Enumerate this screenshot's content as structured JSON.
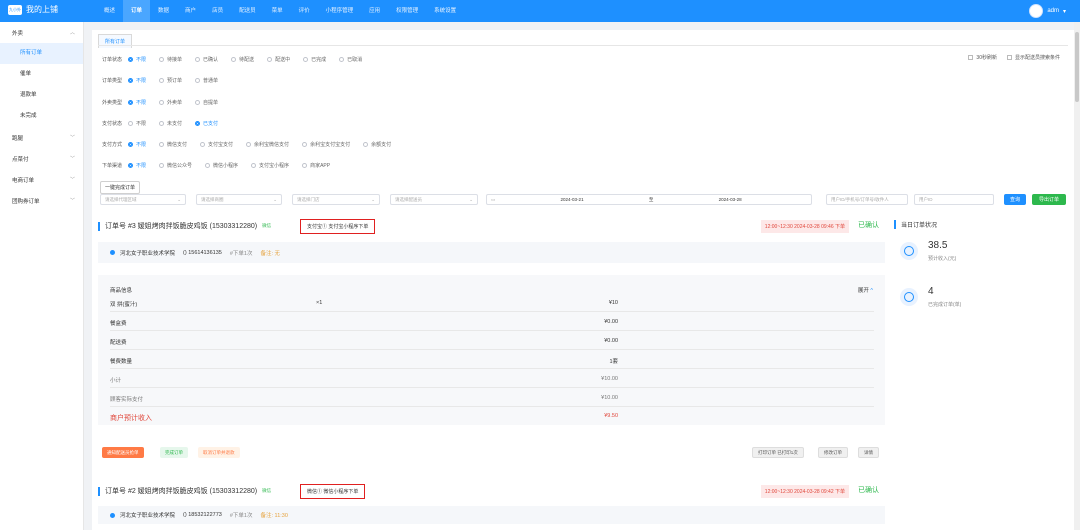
{
  "app": {
    "logo_badge": "九小外",
    "title": "我的上铺",
    "user": "adm"
  },
  "nav": [
    "概述",
    "订单",
    "数据",
    "商户",
    "店员",
    "配送员",
    "菜单",
    "评价",
    "小程序管理",
    "应用",
    "权限管理",
    "系统设置"
  ],
  "sidebar": [
    {
      "label": "外卖",
      "type": "group",
      "chevron": "up"
    },
    {
      "label": "所有订单",
      "type": "item",
      "active": true
    },
    {
      "label": "催单",
      "type": "item"
    },
    {
      "label": "退款单",
      "type": "item"
    },
    {
      "label": "未完成",
      "type": "item"
    },
    {
      "label": "跑腿",
      "type": "group",
      "chevron": "down"
    },
    {
      "label": "点菜付",
      "type": "group",
      "chevron": "down"
    },
    {
      "label": "电商订单",
      "type": "group",
      "chevron": "down"
    },
    {
      "label": "团购券订单",
      "type": "group",
      "chevron": "down"
    }
  ],
  "tab": "所有订单",
  "filters": [
    {
      "label": "订单状态",
      "options": [
        "不限",
        "待接单",
        "已确认",
        "待配送",
        "配送中",
        "已完成",
        "已取消"
      ],
      "selected": 0
    },
    {
      "label": "订单类型",
      "options": [
        "不限",
        "预订单",
        "普通单"
      ],
      "selected": 0
    },
    {
      "label": "外卖类型",
      "options": [
        "不限",
        "外卖单",
        "自提单"
      ],
      "selected": 0
    },
    {
      "label": "支付状态",
      "options": [
        "不限",
        "未支付",
        "已支付"
      ],
      "selected": 2
    },
    {
      "label": "支付方式",
      "options": [
        "不限",
        "微信支付",
        "支付宝支付",
        "余利宝微信支付",
        "余利宝支付宝支付",
        "余额支付"
      ],
      "selected": 0
    },
    {
      "label": "下单渠道",
      "options": [
        "不限",
        "微信公众号",
        "微信小程序",
        "支付宝小程序",
        "商家APP"
      ],
      "selected": 0
    }
  ],
  "right_checks": [
    "30秒刷新",
    "显示配送员搜索条件"
  ],
  "onekey": "一键完成订单",
  "search": {
    "sel1": "请选择代理区域",
    "sel2": "请选择商圈",
    "sel3": "请选择门店",
    "sel4": "请选择配送员",
    "date_from": "2024-03-21",
    "date_sep": "至",
    "date_to": "2024-03-28",
    "ph_order": "用户ID/手机号/订单号/收件人",
    "ph_user": "用户ID",
    "query": "查询",
    "export": "导出订单"
  },
  "colors": {
    "accent": "#1e90ff",
    "green": "#2db84d",
    "red": "#e0463a",
    "orange": "#ff7a45"
  },
  "orders": [
    {
      "title": "订单号 #3 嫒姐烤肉拌饭脆皮鸡饭 (15303312280)",
      "tag": "微信",
      "pay": "支付宝① 支付宝小程序下单",
      "time": "12:00~12:30 2024-03-28 09:46 下单",
      "status": "已确认",
      "school": "河北女子职业技术学院",
      "phone": "() 15614136135",
      "times": "#下单1次",
      "remark": "备注: 无",
      "goods_head": "商品信息",
      "expand": "展开",
      "expand_icon": "^",
      "rows": [
        {
          "a": "双 拼(蜜汁)",
          "b": "×1",
          "c": "¥10"
        },
        {
          "a": "餐盒费",
          "b": "",
          "c": "¥0.00"
        },
        {
          "a": "配送费",
          "b": "",
          "c": "¥0.00"
        },
        {
          "a": "餐费数量",
          "b": "",
          "c": "1套"
        },
        {
          "a": "小计",
          "b": "",
          "c": "¥10.00"
        },
        {
          "a": "顾客实际支付",
          "b": "",
          "c": "¥10.00"
        },
        {
          "a": "商户预计收入",
          "b": "",
          "c": "¥9.50"
        }
      ],
      "btn_assign": "通知配送员抢单",
      "btn_done": "完成订单",
      "btn_cancel": "取消订单并退款",
      "btn_print": "打印订单 已打印1次",
      "btn_edit": "修改订单",
      "btn_detail": "详情"
    },
    {
      "title": "订单号 #2 嫒姐烤肉拌饭脆皮鸡饭 (15303312280)",
      "tag": "微信",
      "pay": "微信① 微信小程序下单",
      "time": "12:00~12:30 2024-03-28 09:42 下单",
      "status": "已确认",
      "school": "河北女子职业技术学院",
      "phone": "() 18532122773",
      "times": "#下单1次",
      "remark": "备注: 11:30"
    }
  ],
  "today": {
    "title": "当日订单状况",
    "income_value": "38.5",
    "income_label": "预计收入(元)",
    "done_value": "4",
    "done_label": "已完成订单(单)"
  }
}
